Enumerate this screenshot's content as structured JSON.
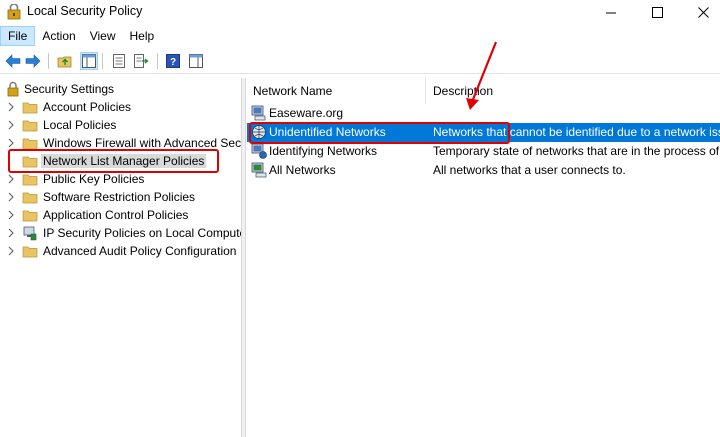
{
  "window": {
    "title": "Local Security Policy",
    "min_label": "",
    "max_label": "",
    "close_label": ""
  },
  "menu": {
    "items": [
      {
        "label": "File",
        "active": true
      },
      {
        "label": "Action",
        "active": false
      },
      {
        "label": "View",
        "active": false
      },
      {
        "label": "Help",
        "active": false
      }
    ]
  },
  "toolbar": {
    "icons": [
      "back-arrow-icon",
      "forward-arrow-icon",
      "up-folder-icon",
      "show-hide-tree-icon",
      "properties-icon",
      "export-list-icon",
      "help-icon",
      "action-pane-icon"
    ]
  },
  "tree": {
    "root": "Security Settings",
    "items": [
      {
        "label": "Account Policies",
        "selected": false,
        "icon": "folder-icon"
      },
      {
        "label": "Local Policies",
        "selected": false,
        "icon": "folder-icon"
      },
      {
        "label": "Windows Firewall with Advanced Security",
        "selected": false,
        "icon": "folder-icon"
      },
      {
        "label": "Network List Manager Policies",
        "selected": true,
        "icon": "folder-icon"
      },
      {
        "label": "Public Key Policies",
        "selected": false,
        "icon": "folder-icon"
      },
      {
        "label": "Software Restriction Policies",
        "selected": false,
        "icon": "folder-icon"
      },
      {
        "label": "Application Control Policies",
        "selected": false,
        "icon": "folder-icon"
      },
      {
        "label": "IP Security Policies on Local Computer",
        "selected": false,
        "icon": "ip-security-icon"
      },
      {
        "label": "Advanced Audit Policy Configuration",
        "selected": false,
        "icon": "folder-icon"
      }
    ]
  },
  "list": {
    "columns": [
      "Network Name",
      "Description"
    ],
    "rows": [
      {
        "name": "Easeware.org",
        "description": "",
        "selected": false
      },
      {
        "name": "Unidentified Networks",
        "description": "Networks that cannot be identified due to a network issue",
        "selected": true
      },
      {
        "name": "Identifying Networks",
        "description": "Temporary state of networks that are in the process of being identified",
        "selected": false
      },
      {
        "name": "All Networks",
        "description": "All networks that a user connects to.",
        "selected": false
      }
    ]
  },
  "colors": {
    "selection": "#0078d7",
    "annotation": "#e00000",
    "folder": "#e8c463"
  }
}
